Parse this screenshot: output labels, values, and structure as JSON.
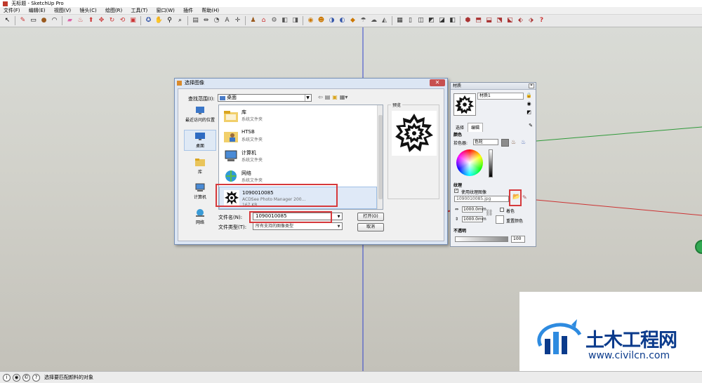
{
  "window": {
    "title": "无标题 - SketchUp Pro"
  },
  "menubar": {
    "items": [
      "文件(F)",
      "编辑(E)",
      "视图(V)",
      "镜头(C)",
      "绘图(R)",
      "工具(T)",
      "窗口(W)",
      "插件",
      "帮助(H)"
    ]
  },
  "toolbar": {
    "icons": [
      "select-icon",
      "pencil-icon",
      "rectangle-icon",
      "circle-icon",
      "arc-icon",
      "eraser-icon",
      "paint-bucket-icon",
      "push-pull-icon",
      "move-icon",
      "rotate-icon",
      "follow-me-icon",
      "scale-icon",
      "offset-icon",
      "tape-icon",
      "dimension-icon",
      "protractor-icon",
      "text-icon",
      "axes-icon",
      "3d-text-icon",
      "orbit-icon",
      "pan-icon",
      "zoom-icon",
      "zoom-window-icon",
      "zoom-extents-icon",
      "previous-view-icon",
      "position-camera-icon",
      "walk-icon",
      "look-around-icon",
      "section-plane-icon",
      "component-icon",
      "warehouse-icon",
      "share-icon",
      "styles-icon",
      "xray-icon",
      "wireframe-icon",
      "hidden-line-icon",
      "shaded-icon",
      "shaded-texture-icon",
      "monochrome-icon",
      "iso-view-icon",
      "top-view-icon",
      "front-view-icon",
      "right-view-icon",
      "back-view-icon",
      "left-view-icon",
      "shadow-icon",
      "fog-icon",
      "sandbox-icon",
      "help-icon"
    ]
  },
  "dialog": {
    "title": "选择图像",
    "look_in_label": "查找范围(I):",
    "look_in_value": "桌面",
    "places": [
      {
        "label": "最近访问的位置"
      },
      {
        "label": "桌面"
      },
      {
        "label": "库"
      },
      {
        "label": "计算机"
      },
      {
        "label": "网络"
      }
    ],
    "files": [
      {
        "name": "库",
        "sub": "系统文件夹",
        "icon": "library-folder-icon"
      },
      {
        "name": "HTSB",
        "sub": "系统文件夹",
        "icon": "user-folder-icon"
      },
      {
        "name": "计算机",
        "sub": "系统文件夹",
        "icon": "computer-icon"
      },
      {
        "name": "网络",
        "sub": "系统文件夹",
        "icon": "network-icon"
      },
      {
        "name": "1090010085",
        "sub": "ACDSee Photo Manager 200...",
        "size": "167 KB",
        "icon": "image-thumbnail"
      }
    ],
    "preview_label": "预览",
    "filename_label": "文件名(N):",
    "filename_value": "1090010085",
    "filetype_label": "文件类型(T):",
    "filetype_value": "所有支持的图像类型",
    "open_button": "打开(O)",
    "cancel_button": "取消"
  },
  "material_panel": {
    "title": "材质",
    "name": "材质1",
    "tab_select": "选择",
    "tab_edit": "编辑",
    "color_section": "颜色",
    "picker_label": "拾色器:",
    "picker_value": "色轮",
    "texture_section": "纹理",
    "use_texture_label": "使用纹理图像",
    "texture_file": "1090010085.jpg",
    "width": "1000.0mm",
    "height": "1000.0mm",
    "colorize_label": "着色",
    "reset_color_label": "重置颜色",
    "opacity_section": "不透明",
    "opacity_value": "100"
  },
  "statusbar": {
    "message": "选择要匹配颜料的对象"
  },
  "watermark": {
    "title": "土木工程网",
    "url": "www.civilcn.com"
  },
  "colors": {
    "annotation_red": "#d6393c",
    "axis_blue": "#3344cc",
    "axis_red": "#cc3333",
    "axis_green": "#2f9a3a",
    "brand_blue": "#0b3b8c"
  }
}
